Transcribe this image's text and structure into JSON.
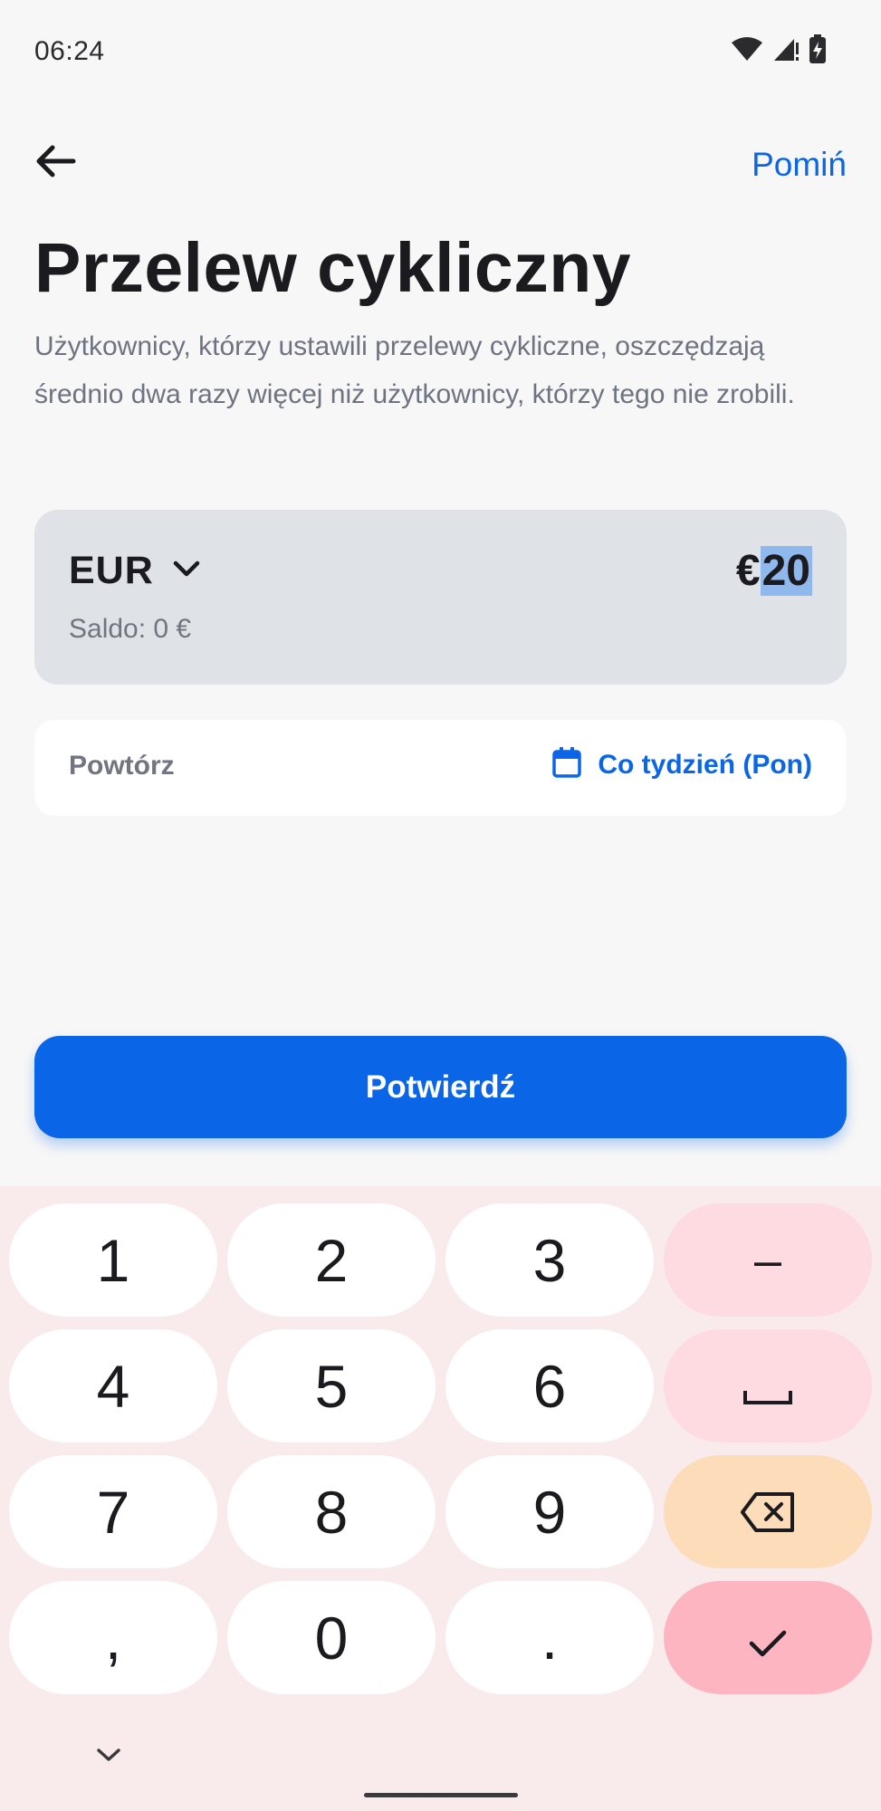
{
  "status_bar": {
    "time": "06:24",
    "icons": [
      "wifi-icon",
      "cell-signal-icon",
      "battery-charging-icon"
    ]
  },
  "header": {
    "back_icon": "arrow-left-icon",
    "skip_label": "Pomiń"
  },
  "page": {
    "title": "Przelew cykliczny",
    "description": "Użytkownicy, którzy ustawili przelewy cykliczne, oszczędzają średnio dwa razy więcej niż użytkownicy, którzy tego nie zrobili."
  },
  "amount_card": {
    "currency": "EUR",
    "balance": "Saldo: 0 €",
    "currency_symbol": "€",
    "amount": "20"
  },
  "repeat": {
    "label": "Powtórz",
    "value": "Co tydzień (Pon)",
    "icon": "calendar-icon"
  },
  "confirm_label": "Potwierdź",
  "keyboard": {
    "keys": {
      "k1": "1",
      "k2": "2",
      "k3": "3",
      "k4": "4",
      "k5": "5",
      "k6": "6",
      "k7": "7",
      "k8": "8",
      "k9": "9",
      "comma": ",",
      "k0": "0",
      "period": ".",
      "minus": "–"
    },
    "function_icons": [
      "space-icon",
      "backspace-icon",
      "check-icon",
      "chevron-down-icon"
    ]
  },
  "colors": {
    "accent": "#0a66e6",
    "card_bg": "#dfe2e6",
    "keyboard_bg": "#f9ebeb",
    "fn_key": "#fddbe0",
    "backspace_key": "#fddcb9",
    "enter_key": "#fdb6c1"
  }
}
